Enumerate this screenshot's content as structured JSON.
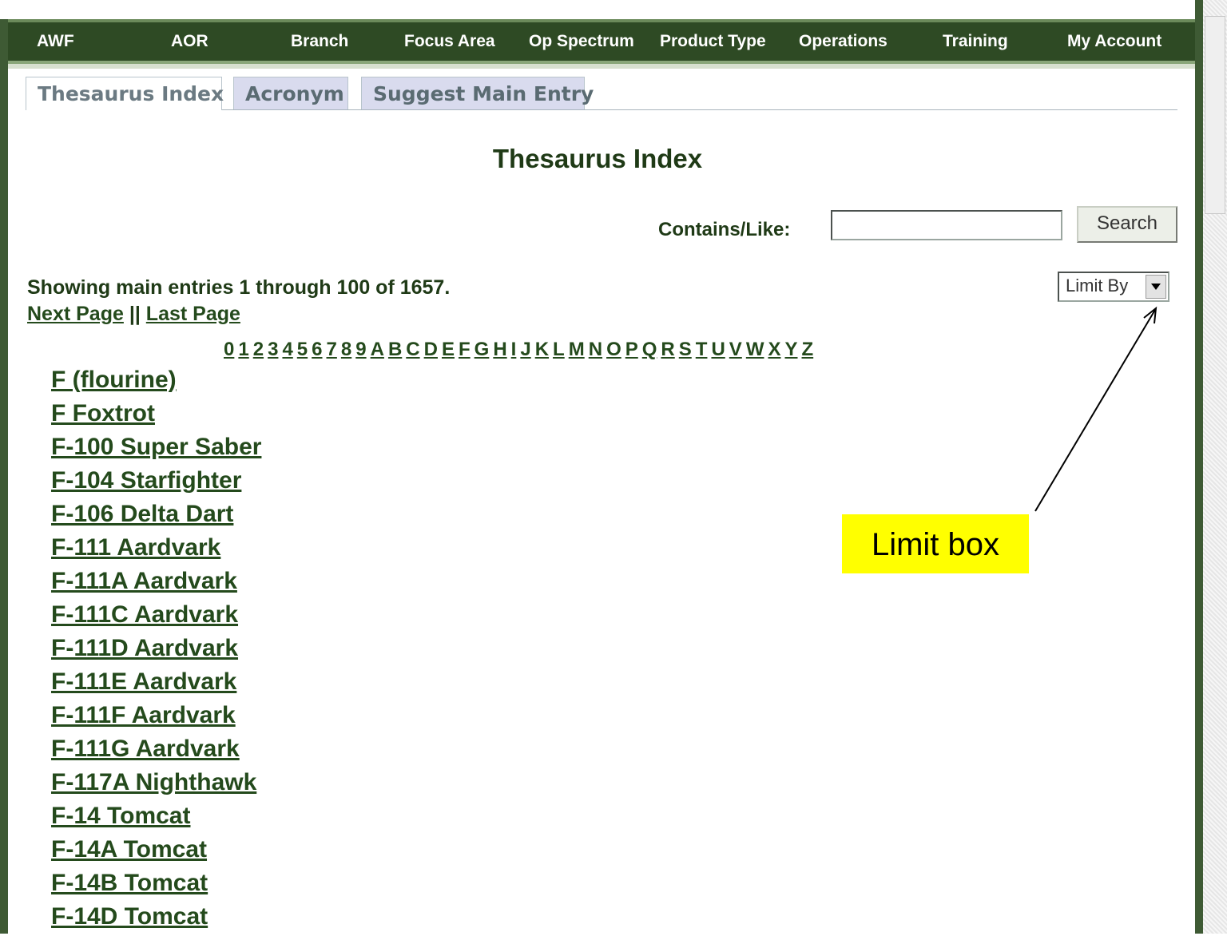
{
  "nav": {
    "items": [
      "AWF",
      "AOR",
      "Branch",
      "Focus Area",
      "Op Spectrum",
      "Product Type",
      "Operations",
      "Training",
      "My Account"
    ]
  },
  "tabs": [
    "Thesaurus Index",
    "Acronym",
    "Suggest Main Entry"
  ],
  "page_title": "Thesaurus Index",
  "search": {
    "label": "Contains/Like:",
    "value": "",
    "button": "Search"
  },
  "results": {
    "showing": "Showing main entries 1 through 100 of 1657.",
    "next_page": "Next Page",
    "separator": "||",
    "last_page": "Last Page"
  },
  "limit": {
    "selected": "Limit By"
  },
  "alphabet": [
    "0",
    "1",
    "2",
    "3",
    "4",
    "5",
    "6",
    "7",
    "8",
    "9",
    "A",
    "B",
    "C",
    "D",
    "E",
    "F",
    "G",
    "H",
    "I",
    "J",
    "K",
    "L",
    "M",
    "N",
    "O",
    "P",
    "Q",
    "R",
    "S",
    "T",
    "U",
    "V",
    "W",
    "X",
    "Y",
    "Z"
  ],
  "entries": [
    "F (flourine)",
    "F Foxtrot",
    "F-100 Super Saber",
    "F-104 Starfighter",
    "F-106 Delta Dart",
    "F-111 Aardvark",
    "F-111A Aardvark",
    "F-111C Aardvark",
    "F-111D Aardvark",
    "F-111E Aardvark",
    "F-111F Aardvark",
    "F-111G Aardvark",
    "F-117A Nighthawk",
    "F-14 Tomcat",
    "F-14A Tomcat",
    "F-14B Tomcat",
    "F-14D Tomcat"
  ],
  "annotation": {
    "label": "Limit box",
    "color": "#ffff00"
  },
  "colors": {
    "nav_background": "#2e4a24",
    "text_dark_green": "#1f3a16",
    "tab_inactive": "#d9dbee"
  }
}
